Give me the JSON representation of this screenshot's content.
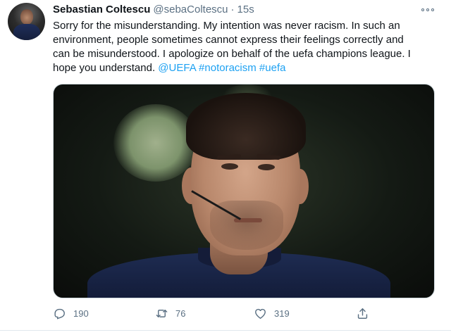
{
  "user": {
    "name": "Sebastian Coltescu",
    "handle": "@sebaColtescu",
    "separator": "·",
    "time": "15s"
  },
  "tweet": {
    "lines": [
      "Sorry for the misunderstanding. My intention was never racism. In such an",
      "environment, people sometimes cannot express their feelings correctly and",
      "can be misunderstood. I apologize on behalf of the uefa champions league. I",
      "hope you understand."
    ],
    "mentions": [
      "@UEFA",
      "#notoracism",
      "#uefa"
    ]
  },
  "media": {
    "description_icon": "photo-referee-portrait"
  },
  "actions": {
    "replies": "190",
    "retweets": "76",
    "likes": "319"
  },
  "colors": {
    "link": "#1da1f2",
    "secondary_text": "#5b7083",
    "primary_text": "#0f1419"
  }
}
